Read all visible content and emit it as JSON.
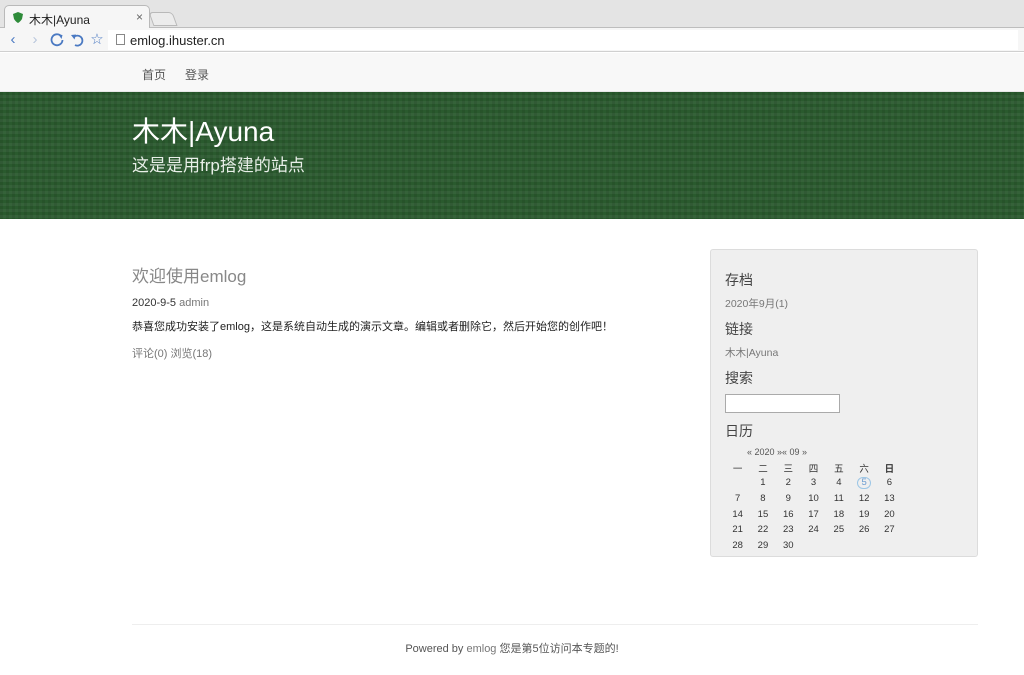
{
  "browser": {
    "tab_title": "木木|Ayuna",
    "tab_close": "×",
    "url": "emlog.ihuster.cn"
  },
  "nav": {
    "items": [
      {
        "label": "首页"
      },
      {
        "label": "登录"
      }
    ]
  },
  "banner": {
    "title": "木木|Ayuna",
    "subtitle": "这是是用frp搭建的站点"
  },
  "post": {
    "title": "欢迎使用emlog",
    "date": "2020-9-5",
    "author": "admin",
    "body": "恭喜您成功安装了emlog，这是系统自动生成的演示文章。编辑或者删除它，然后开始您的创作吧！",
    "comments": "评论(0)",
    "views": "浏览(18)"
  },
  "sidebar": {
    "archive_title": "存档",
    "archive_item": "2020年9月(1)",
    "links_title": "链接",
    "links_item": "木木|Ayuna",
    "search_title": "搜索",
    "search_value": "",
    "calendar_title": "日历",
    "calendar": {
      "header": "« 2020 »« 09 »",
      "weekdays": [
        "一",
        "二",
        "三",
        "四",
        "五",
        "六",
        "日"
      ],
      "weeks": [
        [
          "",
          "1",
          "2",
          "3",
          "4",
          "5",
          "6"
        ],
        [
          "7",
          "8",
          "9",
          "10",
          "11",
          "12",
          "13"
        ],
        [
          "14",
          "15",
          "16",
          "17",
          "18",
          "19",
          "20"
        ],
        [
          "21",
          "22",
          "23",
          "24",
          "25",
          "26",
          "27"
        ],
        [
          "28",
          "29",
          "30",
          "",
          "",
          "",
          ""
        ]
      ],
      "today": "5"
    }
  },
  "footer": {
    "prefix": "Powered by",
    "link": "emlog",
    "suffix": "您是第5位访问本专题的!"
  },
  "colors": {
    "banner": "#2a5a2e",
    "link_gray": "#777777",
    "today_ring": "#9cc6e6"
  }
}
